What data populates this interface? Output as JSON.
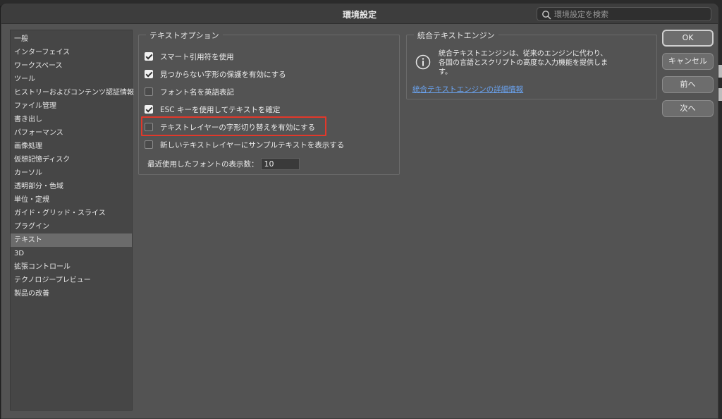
{
  "window": {
    "title": "環境設定"
  },
  "search": {
    "placeholder": "環境設定を検索",
    "icon": "search-icon"
  },
  "sidebar": {
    "items": [
      {
        "label": "一般",
        "active": false
      },
      {
        "label": "インターフェイス",
        "active": false
      },
      {
        "label": "ワークスペース",
        "active": false
      },
      {
        "label": "ツール",
        "active": false
      },
      {
        "label": "ヒストリーおよびコンテンツ認証情報",
        "active": false
      },
      {
        "label": "ファイル管理",
        "active": false
      },
      {
        "label": "書き出し",
        "active": false
      },
      {
        "label": "パフォーマンス",
        "active": false
      },
      {
        "label": "画像処理",
        "active": false
      },
      {
        "label": "仮想記憶ディスク",
        "active": false
      },
      {
        "label": "カーソル",
        "active": false
      },
      {
        "label": "透明部分・色域",
        "active": false
      },
      {
        "label": "単位・定規",
        "active": false
      },
      {
        "label": "ガイド・グリッド・スライス",
        "active": false
      },
      {
        "label": "プラグイン",
        "active": false
      },
      {
        "label": "テキスト",
        "active": true
      },
      {
        "label": "3D",
        "active": false
      },
      {
        "label": "拡張コントロール",
        "active": false
      },
      {
        "label": "テクノロジープレビュー",
        "active": false
      },
      {
        "label": "製品の改善",
        "active": false
      }
    ]
  },
  "text_options": {
    "title": "テキストオプション",
    "options": [
      {
        "label": "スマート引用符を使用",
        "checked": true
      },
      {
        "label": "見つからない字形の保護を有効にする",
        "checked": true
      },
      {
        "label": "フォント名を英語表記",
        "checked": false
      },
      {
        "label": "ESC キーを使用してテキストを確定",
        "checked": true
      },
      {
        "label": "テキストレイヤーの字形切り替えを有効にする",
        "checked": false,
        "highlighted": true
      },
      {
        "label": "新しいテキストレイヤーにサンプルテキストを表示する",
        "checked": false
      }
    ],
    "recent_fonts": {
      "label": "最近使用したフォントの表示数：",
      "value": "10"
    }
  },
  "unified_engine": {
    "title": "統合テキストエンジン",
    "description_lines": [
      "統合テキストエンジンは、従来のエンジンに代わり、",
      "各国の言語とスクリプトの高度な入力機能を提供しま",
      "す。"
    ],
    "link": "統合テキストエンジンの詳細情報",
    "icon": "info-icon"
  },
  "buttons": {
    "ok": "OK",
    "cancel": "キャンセル",
    "prev": "前へ",
    "next": "次へ"
  },
  "colors": {
    "dialog_bg": "#535353",
    "highlight_border": "#e2382a",
    "link": "#6aa3f0"
  }
}
